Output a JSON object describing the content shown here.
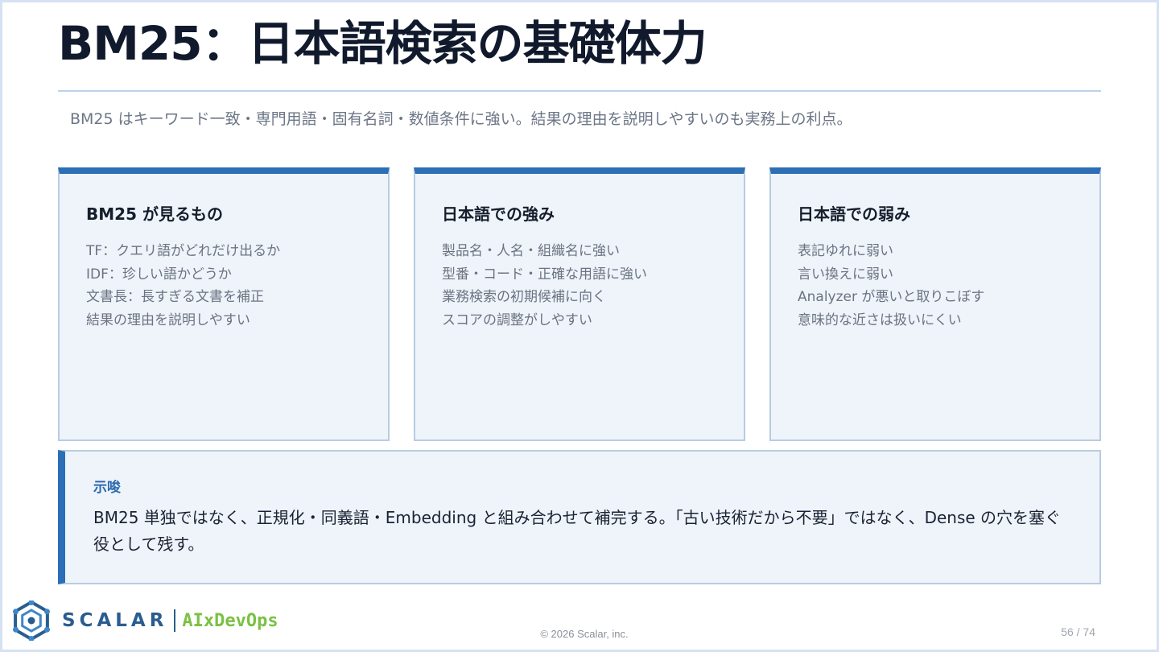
{
  "slide": {
    "title": "BM25：日本語検索の基礎体力",
    "subtitle": "BM25 はキーワード一致・専門用語・固有名詞・数値条件に強い。結果の理由を説明しやすいのも実務上の利点。"
  },
  "cards": [
    {
      "heading": "BM25 が見るもの",
      "items": [
        "TF：クエリ語がどれだけ出るか",
        "IDF：珍しい語かどうか",
        "文書長：長すぎる文書を補正",
        "結果の理由を説明しやすい"
      ]
    },
    {
      "heading": "日本語での強み",
      "items": [
        "製品名・人名・組織名に強い",
        "型番・コード・正確な用語に強い",
        "業務検索の初期候補に向く",
        "スコアの調整がしやすい"
      ]
    },
    {
      "heading": "日本語での弱み",
      "items": [
        "表記ゆれに弱い",
        "言い換えに弱い",
        "Analyzer が悪いと取りこぼす",
        "意味的な近さは扱いにくい"
      ]
    }
  ],
  "insight": {
    "label": "示唆",
    "body": "BM25 単独ではなく、正規化・同義語・Embedding と組み合わせて補完する。「古い技術だから不要」ではなく、Dense の穴を塞ぐ役として残す。"
  },
  "footer": {
    "brand": "SCALAR",
    "product": "AIxDevOps",
    "copyright": "© 2026 Scalar, inc.",
    "page": "56 / 74"
  },
  "colors": {
    "accent": "#2c6fb6",
    "card_bg": "#eff4fa",
    "card_border": "#b7cce4",
    "brand": "#2a5d8f",
    "product": "#7ac143"
  }
}
